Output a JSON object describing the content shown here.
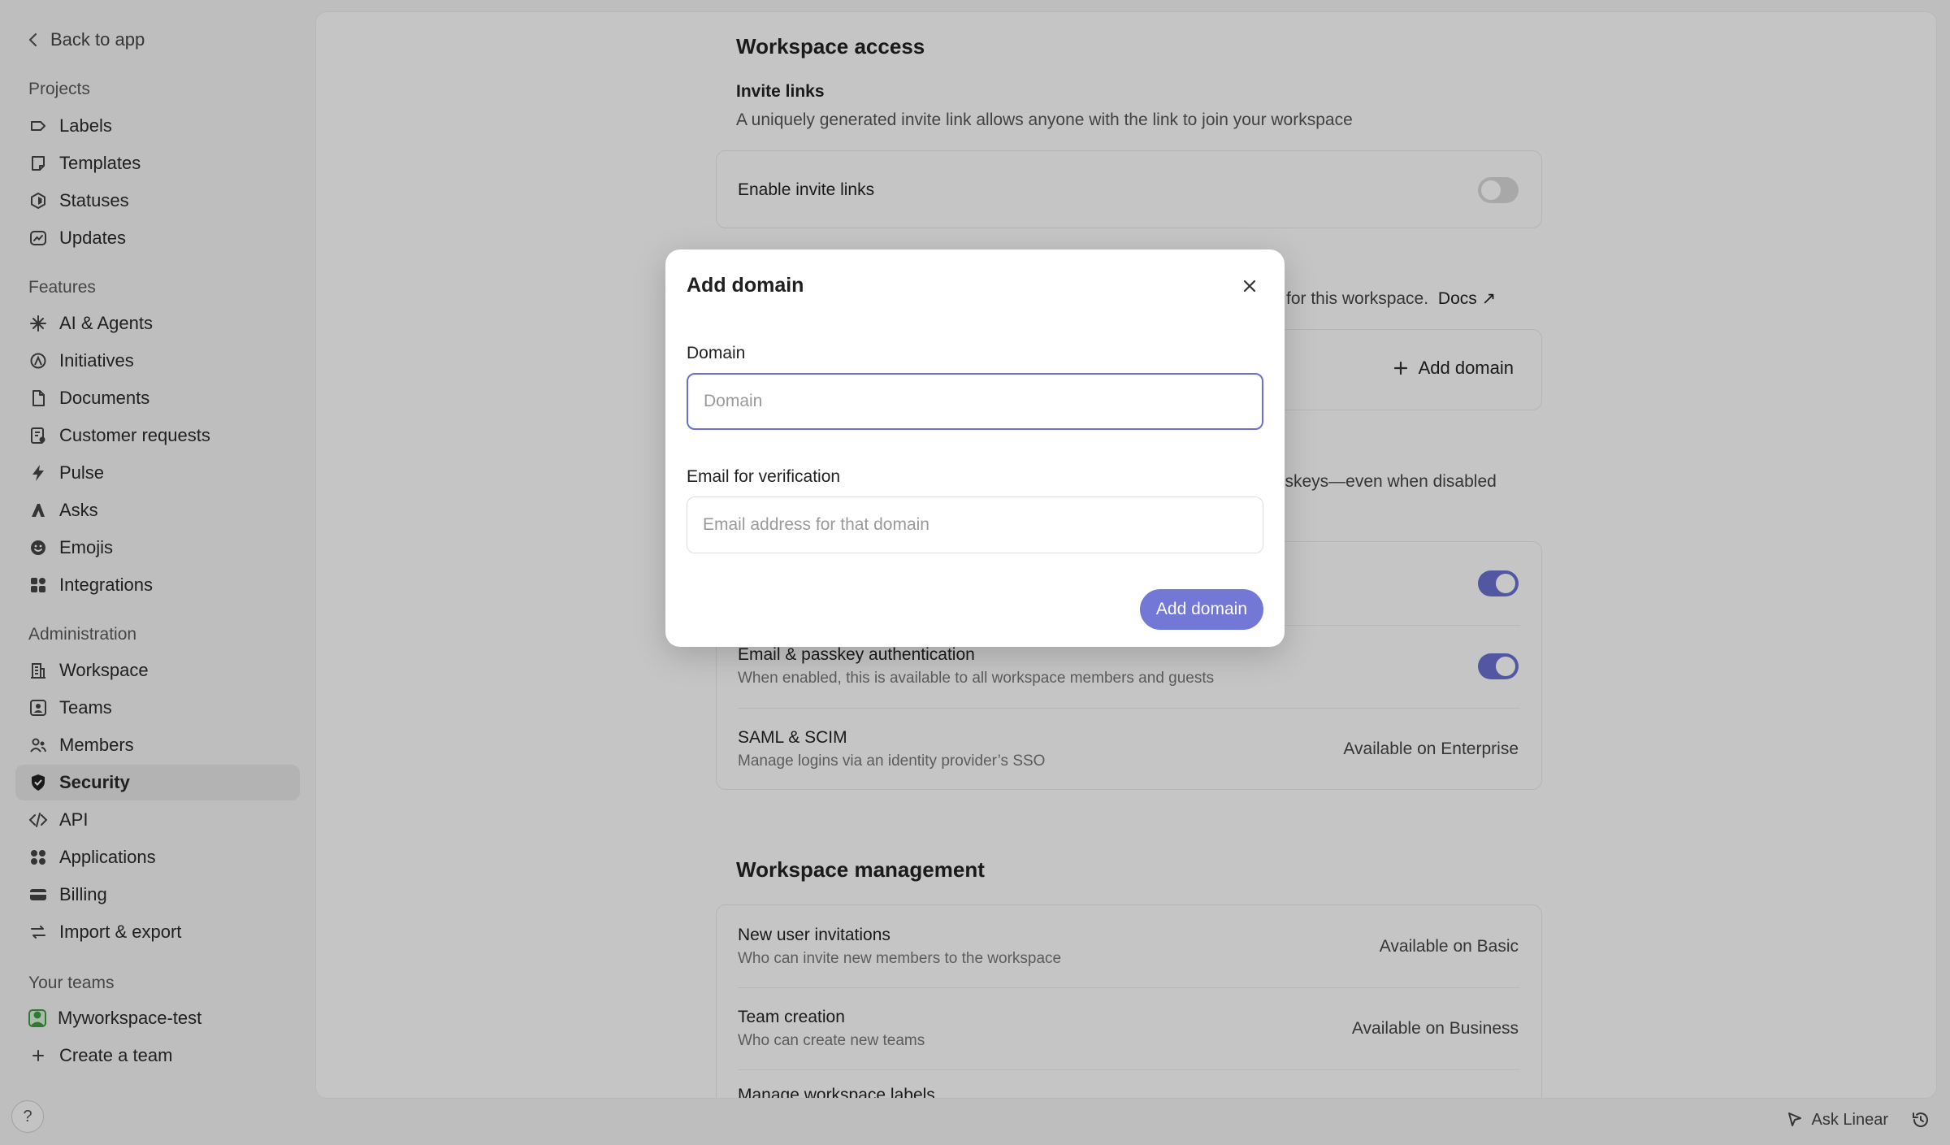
{
  "sidebar": {
    "back_label": "Back to app",
    "sections": {
      "projects": "Projects",
      "features": "Features",
      "administration": "Administration",
      "your_teams": "Your teams"
    },
    "projects": [
      "Labels",
      "Templates",
      "Statuses",
      "Updates"
    ],
    "features": [
      "AI & Agents",
      "Initiatives",
      "Documents",
      "Customer requests",
      "Pulse",
      "Asks",
      "Emojis",
      "Integrations"
    ],
    "administration": [
      "Workspace",
      "Teams",
      "Members",
      "Security",
      "API",
      "Applications",
      "Billing",
      "Import & export"
    ],
    "active_item": "Security",
    "teams": [
      "Myworkspace-test"
    ],
    "create_team": "Create a team",
    "help": "?"
  },
  "main": {
    "workspace_access": {
      "title": "Workspace access",
      "invite_title": "Invite links",
      "invite_desc": "A uniquely generated invite link allows anyone with the link to join your workspace",
      "enable_invite_label": "Enable invite links",
      "enable_invite_on": false,
      "domains_desc_tail": "for this workspace.",
      "docs_link": "Docs ↗",
      "add_domain_label": "Add domain",
      "auth_desc_tail": "sskeys—even when disabled",
      "auth_toggle_1_on": true,
      "email_passkey_title": "Email & passkey authentication",
      "email_passkey_desc": "When enabled, this is available to all workspace members and guests",
      "email_passkey_on": true,
      "saml_title": "SAML & SCIM",
      "saml_desc": "Manage logins via an identity provider’s SSO",
      "saml_status": "Available on Enterprise"
    },
    "workspace_management": {
      "title": "Workspace management",
      "rows": [
        {
          "title": "New user invitations",
          "desc": "Who can invite new members to the workspace",
          "status": "Available on Basic"
        },
        {
          "title": "Team creation",
          "desc": "Who can create new teams",
          "status": "Available on Business"
        },
        {
          "title": "Manage workspace labels",
          "desc": "",
          "status": ""
        }
      ]
    }
  },
  "bottom_bar": {
    "ask_label": "Ask Linear"
  },
  "modal": {
    "title": "Add domain",
    "domain_label": "Domain",
    "domain_value": "",
    "domain_placeholder": "Domain",
    "email_label": "Email for verification",
    "email_value": "",
    "email_placeholder": "Email address for that domain",
    "submit_label": "Add domain"
  },
  "colors": {
    "accent": "#6b6fce",
    "button": "#7378d6",
    "overlay": "rgba(0,0,0,0.22)",
    "team_badge": "#3e9b43"
  }
}
